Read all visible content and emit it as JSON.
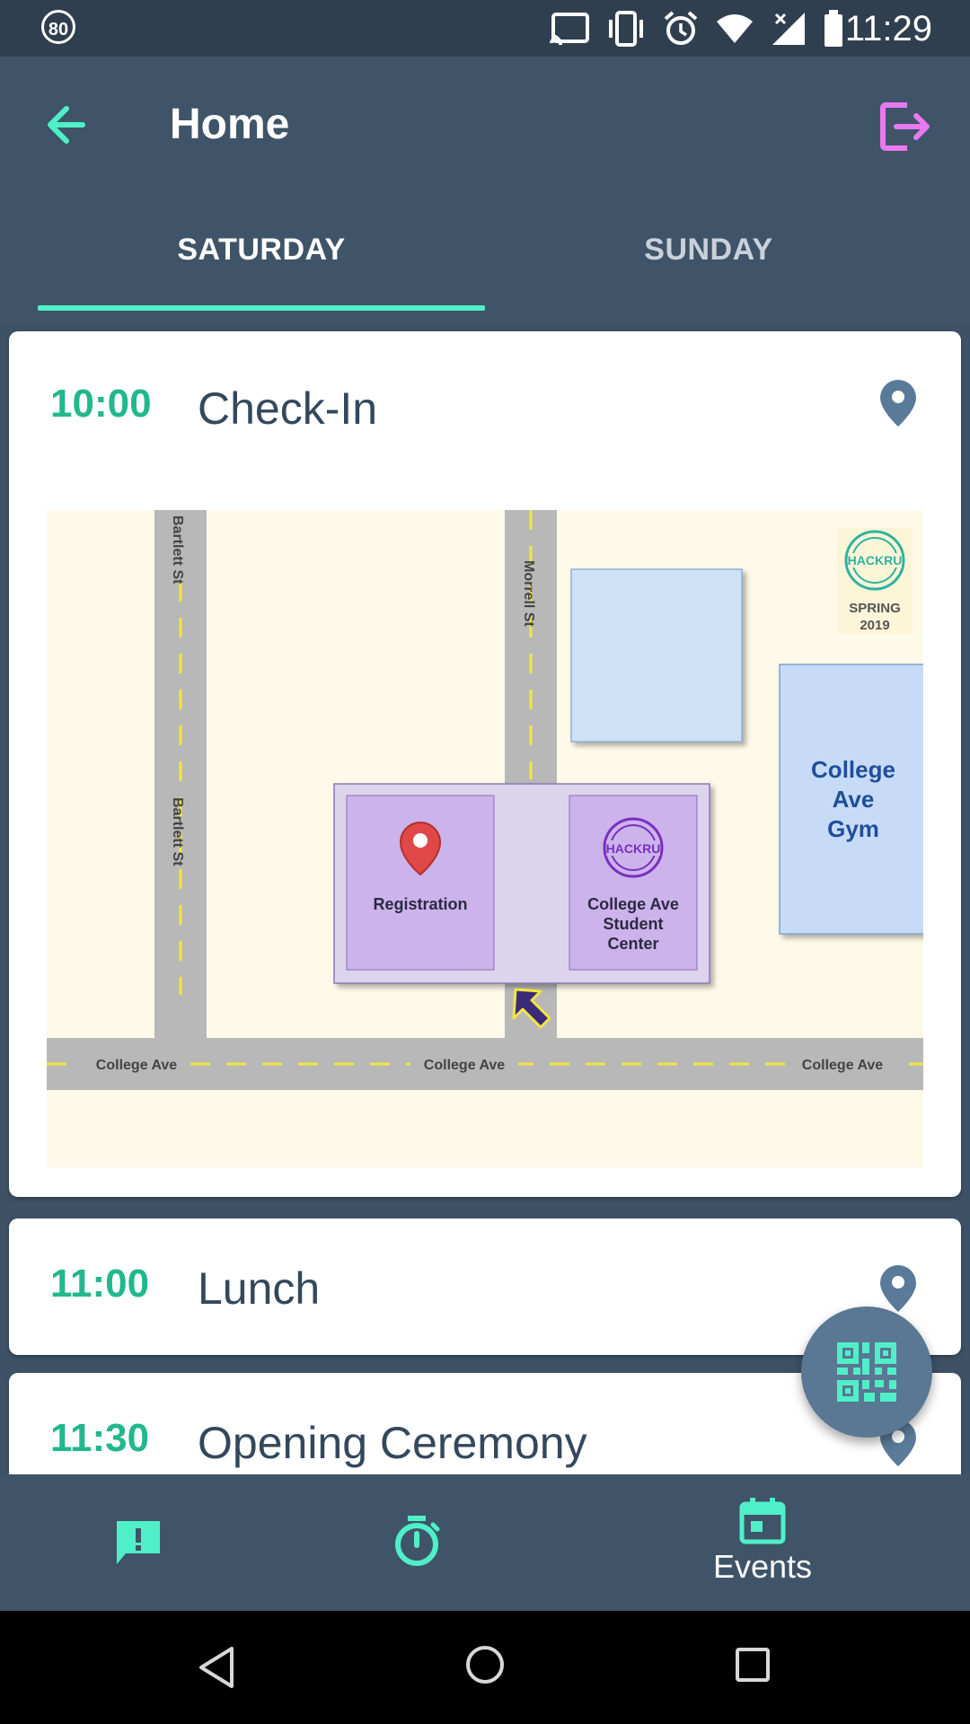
{
  "statusbar": {
    "badge": "80",
    "time": "11:29"
  },
  "appbar": {
    "title": "Home"
  },
  "tabs": [
    {
      "label": "SATURDAY",
      "selected": true
    },
    {
      "label": "SUNDAY",
      "selected": false
    }
  ],
  "events": [
    {
      "time": "10:00",
      "name": "Check-In"
    },
    {
      "time": "11:00",
      "name": "Lunch"
    },
    {
      "time": "11:30",
      "name": "Opening Ceremony"
    }
  ],
  "map": {
    "streets": {
      "bartlett": "Bartlett St",
      "morrell": "Morrell St",
      "college_ave": "College Ave"
    },
    "logo_text": "HACKRU",
    "season": "SPRING",
    "year": "2019",
    "gym_line1": "College",
    "gym_line2": "Ave",
    "gym_line3": "Gym",
    "registration": "Registration",
    "student_center_line1": "College Ave",
    "student_center_line2": "Student",
    "student_center_line3": "Center"
  },
  "bottomnav": {
    "events_label": "Events"
  },
  "colors": {
    "accent": "#4ff0c8",
    "time_green": "#22b88f",
    "appbar": "#3f5468",
    "logout_pink": "#e879f0"
  }
}
